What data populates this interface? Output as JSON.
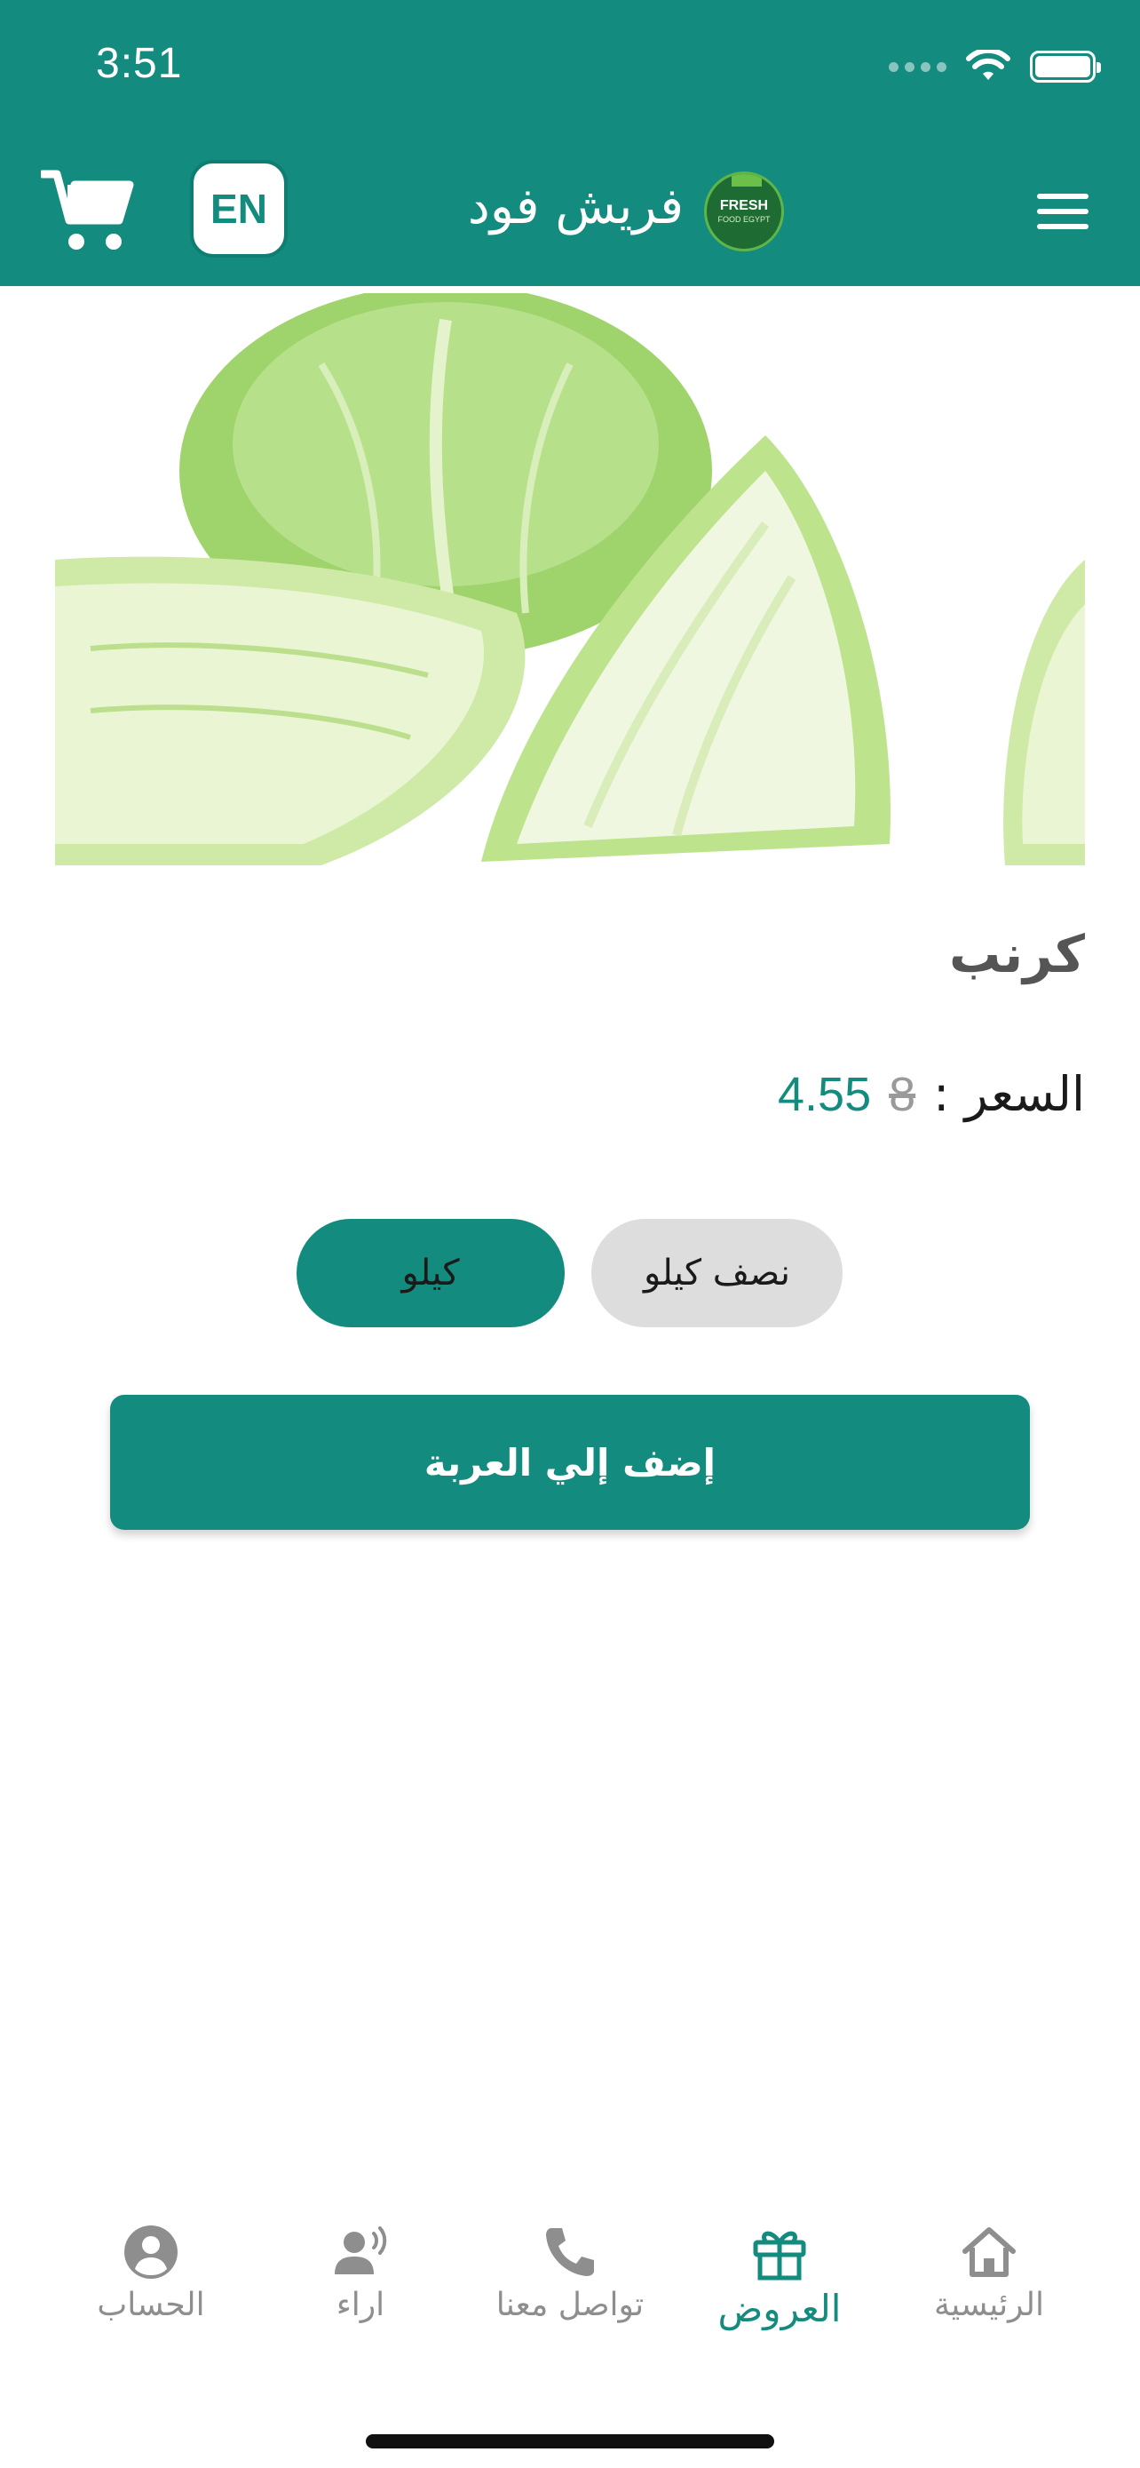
{
  "status_bar": {
    "time": "3:51"
  },
  "header": {
    "app_title": "فريش فود",
    "language_button": "EN",
    "logo_text_top": "FRESH",
    "logo_text_bottom": "FOOD EGYPT"
  },
  "product": {
    "name": "كرنب",
    "price_label": "السعر :",
    "old_price": "8",
    "new_price": "4.55"
  },
  "options": [
    {
      "label": "نصف كيلو",
      "selected": false
    },
    {
      "label": "كيلو",
      "selected": true
    }
  ],
  "add_to_cart_label": "إضف إلي العربة",
  "bottom_nav": [
    {
      "label": "الرئيسية",
      "icon": "home-icon",
      "active": false
    },
    {
      "label": "العروض",
      "icon": "gift-icon",
      "active": true
    },
    {
      "label": "تواصل معنا",
      "icon": "phone-icon",
      "active": false
    },
    {
      "label": "اراء",
      "icon": "reviews-icon",
      "active": false
    },
    {
      "label": "الحساب",
      "icon": "account-icon",
      "active": false
    }
  ],
  "colors": {
    "primary": "#138b7e",
    "inactive": "#8e8e8e",
    "option_unselected": "#dddddd"
  }
}
